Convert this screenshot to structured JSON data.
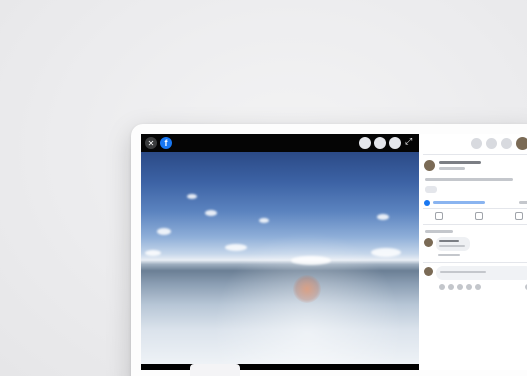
{
  "viewer": {
    "close_glyph": "✕",
    "logo_glyph": "f",
    "expand_glyph": "⤢",
    "toolbar_icons": [
      "zoom-in-icon",
      "zoom-out-icon",
      "tag-icon"
    ]
  },
  "panel": {
    "topbar_icons": [
      "menu-grid-icon",
      "messenger-icon",
      "notifications-icon",
      "account-avatar"
    ]
  },
  "colors": {
    "brand": "#1877f2",
    "viewer_bg": "#000000",
    "panel_bg": "#ffffff"
  }
}
